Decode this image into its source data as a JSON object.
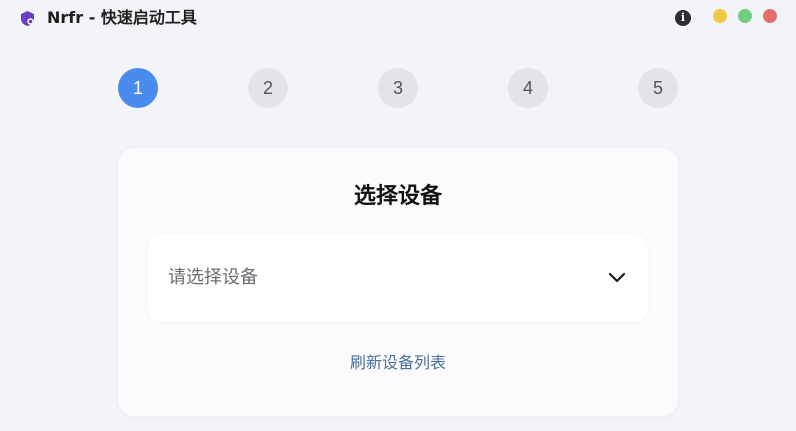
{
  "app": {
    "title": "Nrfr - 快速启动工具",
    "accent_color": "#4a8bf0",
    "logo_color": "#6b3cc6"
  },
  "window_controls": {
    "info_icon": "i",
    "minimize_color": "#f2c744",
    "maximize_color": "#6fcf80",
    "close_color": "#e07070"
  },
  "steps": [
    {
      "label": "1",
      "active": true
    },
    {
      "label": "2",
      "active": false
    },
    {
      "label": "3",
      "active": false
    },
    {
      "label": "4",
      "active": false
    },
    {
      "label": "5",
      "active": false
    }
  ],
  "card": {
    "title": "选择设备",
    "select": {
      "placeholder": "请选择设备",
      "icon": "chevron-down-icon"
    },
    "refresh_label": "刷新设备列表"
  }
}
